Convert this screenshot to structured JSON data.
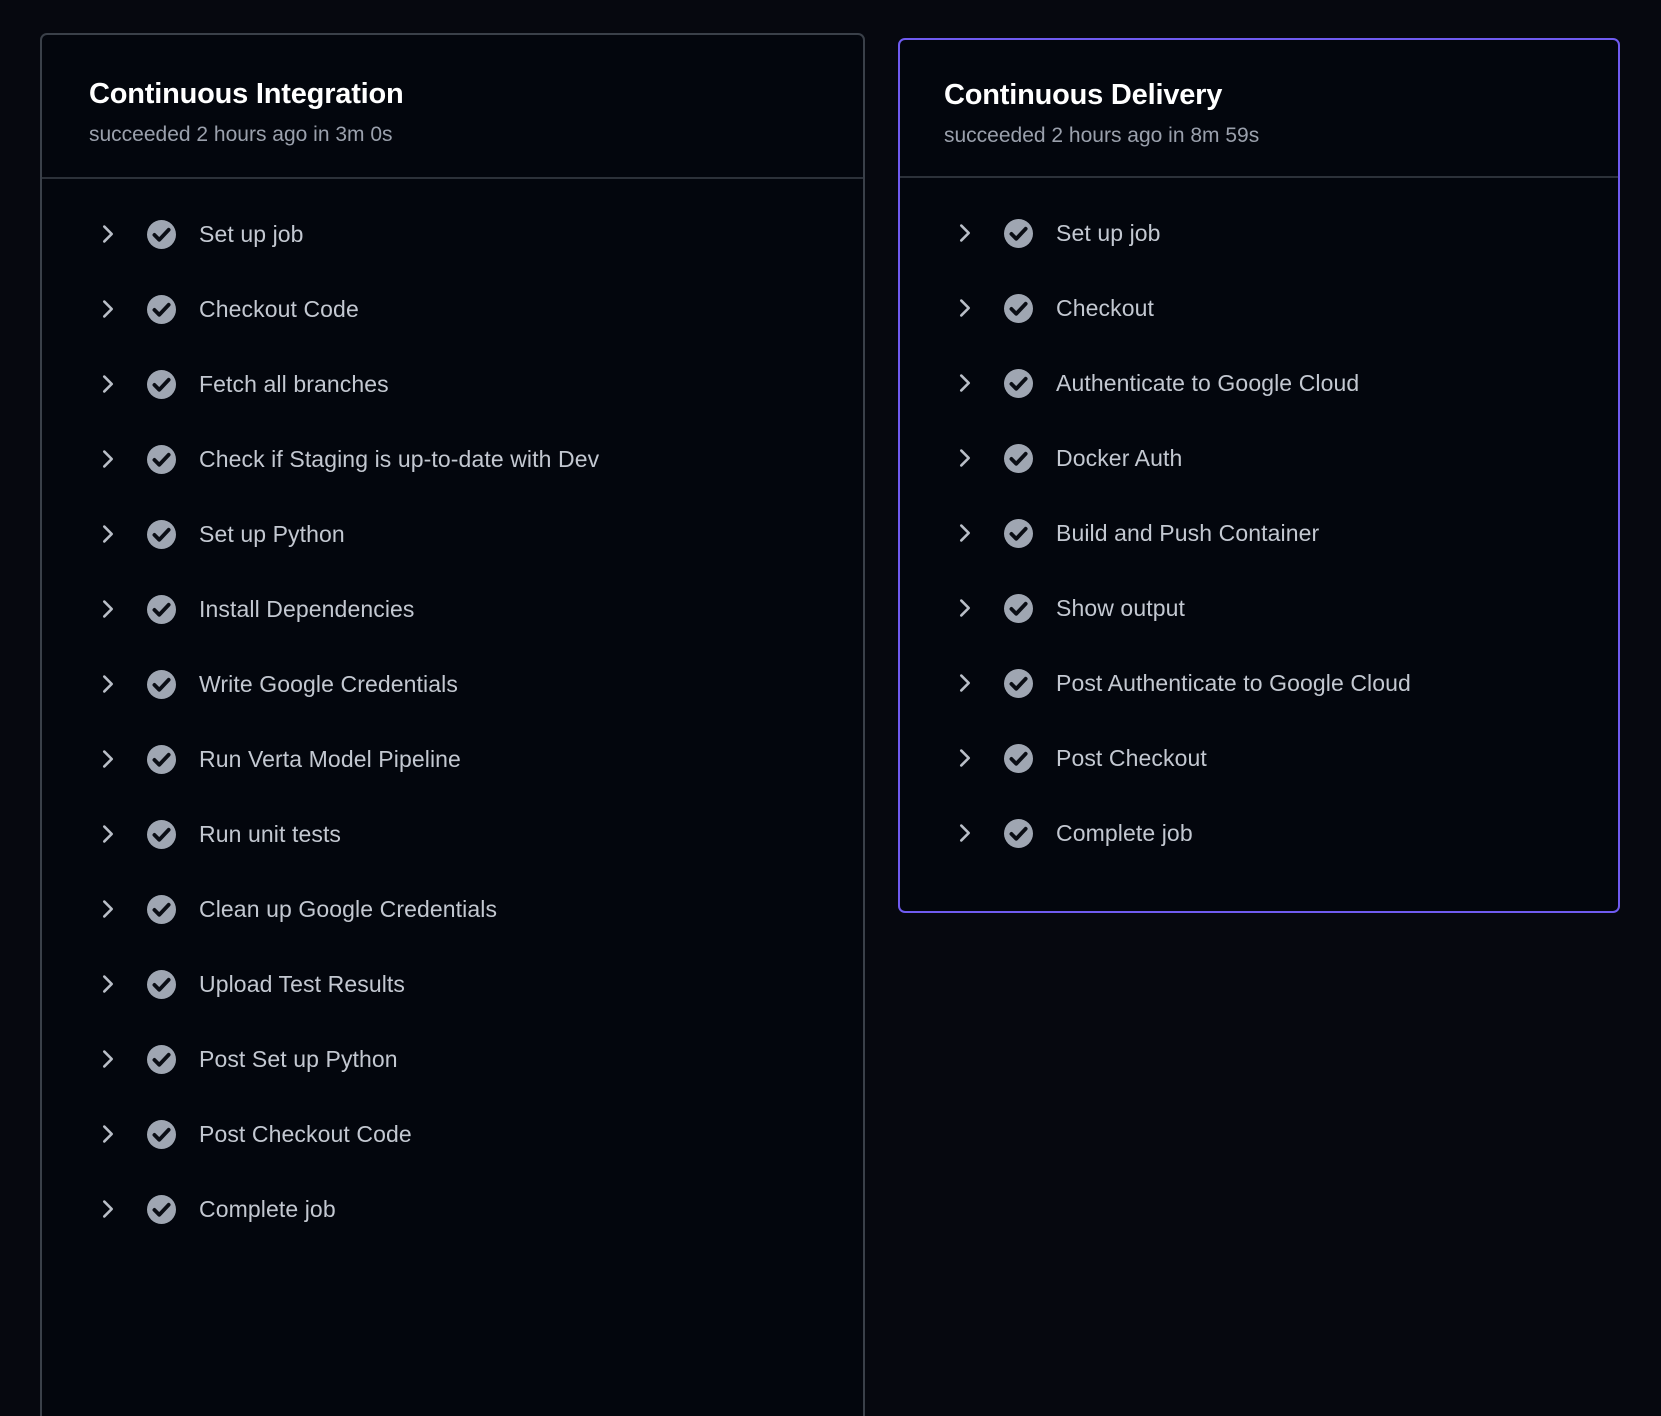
{
  "theme": {
    "background": "#06080f",
    "panel_background": "#03060d",
    "panel_border": "#3a4049",
    "accent_border": "#6f5bf0",
    "title_color": "#ffffff",
    "subtitle_color": "#9aa0ac",
    "step_label_color": "#c3c8d1",
    "icon_circle_color": "#9fa6b2",
    "chevron_color": "#b9bec7"
  },
  "panels": [
    {
      "id": "continuous-integration",
      "title": "Continuous Integration",
      "subtitle": "succeeded 2 hours ago in 3m 0s",
      "selected": false,
      "steps": [
        {
          "label": "Set up job",
          "status": "succeeded",
          "expand_icon": "chevron-right-icon",
          "status_icon": "check-circle-icon"
        },
        {
          "label": "Checkout Code",
          "status": "succeeded",
          "expand_icon": "chevron-right-icon",
          "status_icon": "check-circle-icon"
        },
        {
          "label": "Fetch all branches",
          "status": "succeeded",
          "expand_icon": "chevron-right-icon",
          "status_icon": "check-circle-icon"
        },
        {
          "label": "Check if Staging is up-to-date with Dev",
          "status": "succeeded",
          "expand_icon": "chevron-right-icon",
          "status_icon": "check-circle-icon"
        },
        {
          "label": "Set up Python",
          "status": "succeeded",
          "expand_icon": "chevron-right-icon",
          "status_icon": "check-circle-icon"
        },
        {
          "label": "Install Dependencies",
          "status": "succeeded",
          "expand_icon": "chevron-right-icon",
          "status_icon": "check-circle-icon"
        },
        {
          "label": "Write Google Credentials",
          "status": "succeeded",
          "expand_icon": "chevron-right-icon",
          "status_icon": "check-circle-icon"
        },
        {
          "label": "Run Verta Model Pipeline",
          "status": "succeeded",
          "expand_icon": "chevron-right-icon",
          "status_icon": "check-circle-icon"
        },
        {
          "label": "Run unit tests",
          "status": "succeeded",
          "expand_icon": "chevron-right-icon",
          "status_icon": "check-circle-icon"
        },
        {
          "label": "Clean up Google Credentials",
          "status": "succeeded",
          "expand_icon": "chevron-right-icon",
          "status_icon": "check-circle-icon"
        },
        {
          "label": "Upload Test Results",
          "status": "succeeded",
          "expand_icon": "chevron-right-icon",
          "status_icon": "check-circle-icon"
        },
        {
          "label": "Post Set up Python",
          "status": "succeeded",
          "expand_icon": "chevron-right-icon",
          "status_icon": "check-circle-icon"
        },
        {
          "label": "Post Checkout Code",
          "status": "succeeded",
          "expand_icon": "chevron-right-icon",
          "status_icon": "check-circle-icon"
        },
        {
          "label": "Complete job",
          "status": "succeeded",
          "expand_icon": "chevron-right-icon",
          "status_icon": "check-circle-icon"
        }
      ]
    },
    {
      "id": "continuous-delivery",
      "title": "Continuous Delivery",
      "subtitle": "succeeded 2 hours ago in 8m 59s",
      "selected": true,
      "steps": [
        {
          "label": "Set up job",
          "status": "succeeded",
          "expand_icon": "chevron-right-icon",
          "status_icon": "check-circle-icon"
        },
        {
          "label": "Checkout",
          "status": "succeeded",
          "expand_icon": "chevron-right-icon",
          "status_icon": "check-circle-icon"
        },
        {
          "label": "Authenticate to Google Cloud",
          "status": "succeeded",
          "expand_icon": "chevron-right-icon",
          "status_icon": "check-circle-icon"
        },
        {
          "label": "Docker Auth",
          "status": "succeeded",
          "expand_icon": "chevron-right-icon",
          "status_icon": "check-circle-icon"
        },
        {
          "label": "Build and Push Container",
          "status": "succeeded",
          "expand_icon": "chevron-right-icon",
          "status_icon": "check-circle-icon"
        },
        {
          "label": "Show output",
          "status": "succeeded",
          "expand_icon": "chevron-right-icon",
          "status_icon": "check-circle-icon"
        },
        {
          "label": "Post Authenticate to Google Cloud",
          "status": "succeeded",
          "expand_icon": "chevron-right-icon",
          "status_icon": "check-circle-icon"
        },
        {
          "label": "Post Checkout",
          "status": "succeeded",
          "expand_icon": "chevron-right-icon",
          "status_icon": "check-circle-icon"
        },
        {
          "label": "Complete job",
          "status": "succeeded",
          "expand_icon": "chevron-right-icon",
          "status_icon": "check-circle-icon"
        }
      ]
    }
  ]
}
